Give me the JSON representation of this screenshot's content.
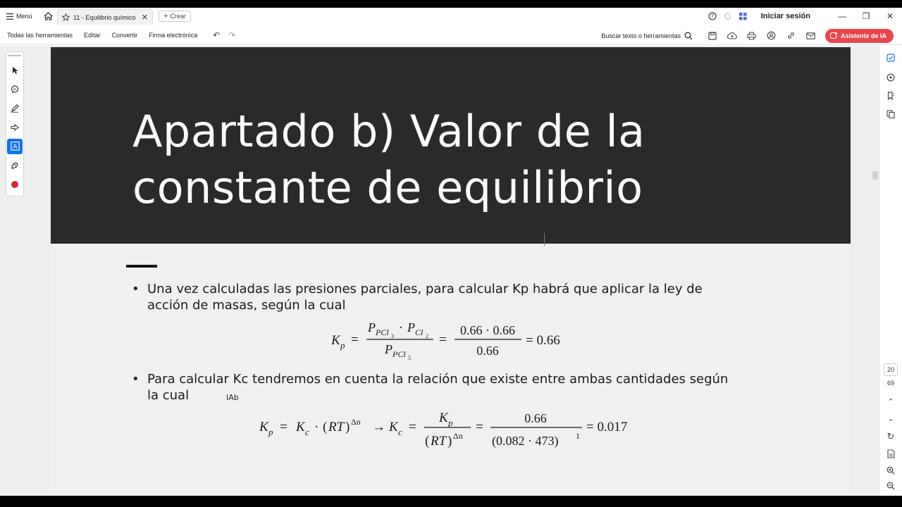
{
  "titlebar": {
    "menu_label": "Menú",
    "tab_label": "11 - Equilibrio químico",
    "create_label": "Crear",
    "signin_label": "Iniciar sesión"
  },
  "toolbar": {
    "all_tools": "Todas las herramientas",
    "edit": "Editar",
    "convert": "Convertir",
    "sign": "Firma electrónica",
    "search_placeholder": "Buscar texto o herramientas",
    "ai_assistant": "Asistente de IA"
  },
  "slide": {
    "title_line1": "Apartado b) Valor de la",
    "title_line2": "constante de equilibrio",
    "bullet1_line1": "Una vez calculadas las presiones parciales, para calcular Kp habrá que aplicar la ley de",
    "bullet1_line2": "acción de masas, según la cual",
    "bullet2_line1": "Para calcular Kc tendremos en cuenta la relación que existe entre ambas cantidades según",
    "bullet2_line2": "la cual",
    "formula1": {
      "num_val": "0.66 · 0.66",
      "den_val": "0.66",
      "result": "= 0.66"
    },
    "formula2": {
      "num_val": "0.66",
      "den_val": "(0.082 · 473)",
      "den_exp": "1",
      "result": "= 0.017"
    },
    "cursor_label": "Ab"
  },
  "viewer": {
    "current_page": "20",
    "total_pages": "69"
  },
  "colors": {
    "banner": "#2a2a2a",
    "accent": "#1473e6",
    "ai_button": "#e8484d"
  }
}
